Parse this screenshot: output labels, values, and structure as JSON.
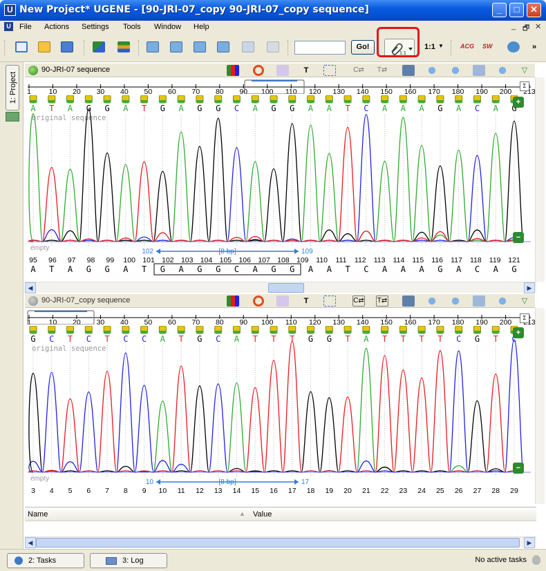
{
  "window": {
    "title": "New Project* UGENE - [90-JRI-07_copy 90-JRI-07_copy sequence]",
    "logo_letter": "U",
    "minimize": "_",
    "maximize": "□",
    "close": "✕"
  },
  "menu": {
    "items": [
      "File",
      "Actions",
      "Settings",
      "Tools",
      "Window",
      "Help"
    ],
    "mdi_controls": [
      "_",
      "🗗",
      "✕"
    ]
  },
  "toolbar": {
    "search_value": "",
    "go_label": "Go!",
    "zoom_label": "1:1",
    "acg_label": "ACG",
    "sw_label": "SW",
    "more_label": "»",
    "highlight_color": "#e8121b"
  },
  "sidebar": {
    "project_tab": "1: Project"
  },
  "panels": [
    {
      "name": "90-JRI-07 sequence",
      "ruler_ticks": [
        "1",
        "10",
        "20",
        "30",
        "40",
        "50",
        "60",
        "70",
        "80",
        "90",
        "100",
        "110",
        "120",
        "130",
        "140",
        "150",
        "160",
        "170",
        "180",
        "190",
        "200",
        "213"
      ],
      "bases": [
        "A",
        "T",
        "A",
        "G",
        "G",
        "A",
        "T",
        "G",
        "A",
        "G",
        "G",
        "C",
        "A",
        "G",
        "G",
        "A",
        "A",
        "T",
        "C",
        "A",
        "A",
        "A",
        "G",
        "A",
        "C",
        "A",
        "G"
      ],
      "annotation": "original sequence",
      "empty_label": "empty",
      "selection": {
        "start": "102",
        "end": "109",
        "length": "[8 bp]"
      },
      "position_numbers": [
        "95",
        "96",
        "97",
        "98",
        "99",
        "100",
        "101",
        "102",
        "103",
        "104",
        "105",
        "106",
        "107",
        "108",
        "109",
        "110",
        "111",
        "112",
        "113",
        "114",
        "115",
        "116",
        "117",
        "118",
        "119",
        "121"
      ],
      "bottom_bases": [
        "A",
        "T",
        "A",
        "G",
        "G",
        "A",
        "T",
        "G",
        "A",
        "G",
        "G",
        "C",
        "A",
        "G",
        "G",
        "A",
        "A",
        "T",
        "C",
        "A",
        "A",
        "A",
        "G",
        "A",
        "C",
        "A",
        "G"
      ]
    },
    {
      "name": "90-JRI-07_copy sequence",
      "ruler_ticks": [
        "1",
        "10",
        "20",
        "30",
        "40",
        "50",
        "60",
        "70",
        "80",
        "90",
        "100",
        "110",
        "120",
        "130",
        "140",
        "150",
        "160",
        "170",
        "180",
        "190",
        "200",
        "213"
      ],
      "bases": [
        "G",
        "C",
        "T",
        "C",
        "T",
        "C",
        "C",
        "A",
        "T",
        "G",
        "C",
        "A",
        "T",
        "T",
        "T",
        "G",
        "G",
        "T",
        "A",
        "T",
        "T",
        "T",
        "T",
        "C",
        "G",
        "T",
        "C"
      ],
      "annotation": "original sequence",
      "empty_label": "empty",
      "selection": {
        "start": "10",
        "end": "17",
        "length": "[8 bp]"
      },
      "position_numbers": [
        "3",
        "4",
        "5",
        "6",
        "7",
        "8",
        "9",
        "10",
        "11",
        "12",
        "13",
        "14",
        "15",
        "16",
        "17",
        "18",
        "19",
        "20",
        "21",
        "22",
        "23",
        "24",
        "25",
        "26",
        "27",
        "28",
        "29"
      ]
    }
  ],
  "base_colors": {
    "A": "#2eaa2e",
    "C": "#2121e6",
    "G": "#000000",
    "T": "#e8191e"
  },
  "props": {
    "name_header": "Name",
    "value_header": "Value"
  },
  "statusbar": {
    "tasks_tab": "2: Tasks",
    "log_tab": "3: Log",
    "status": "No active tasks"
  }
}
